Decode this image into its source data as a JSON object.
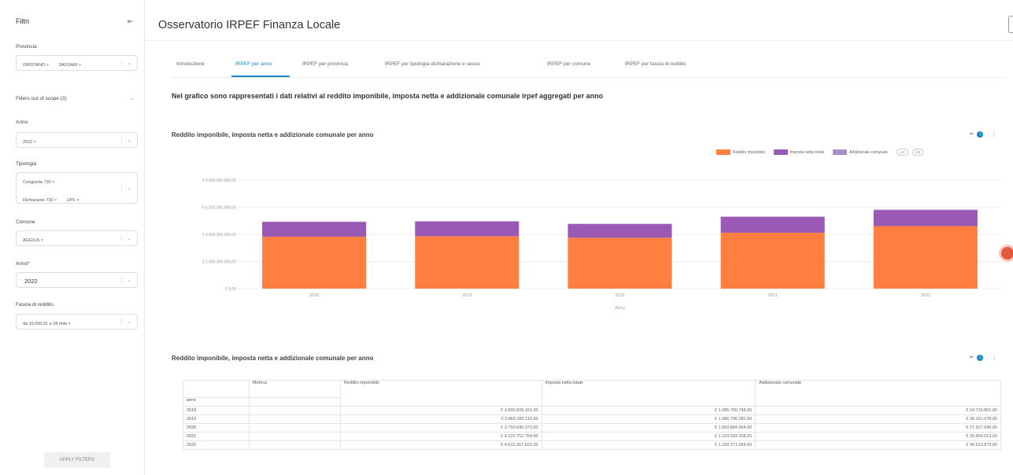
{
  "sidebar": {
    "title": "Filtri",
    "collapse_icon": "collapse-panel-icon",
    "filters": [
      {
        "label": "Provincia",
        "tags": [
          "ORISTANO ×",
          "SASSARI ×"
        ]
      },
      {
        "label": "Filters out of scope (3)"
      },
      {
        "label": "Anno",
        "tags": [
          "2022 ×"
        ]
      },
      {
        "label": "Tipologia",
        "tags_row1": [
          "Congiunta 730 ×"
        ],
        "tags_row2": [
          "Dichiarante 730 ×",
          "UPF ×"
        ]
      },
      {
        "label": "Comune",
        "tags": [
          "AGGIUS ×"
        ]
      },
      {
        "label": "Anno*",
        "value": "2022"
      },
      {
        "label": "Fascia di reddito",
        "tags": [
          "da 15.000,01 a 28 mila ×"
        ]
      }
    ],
    "apply_label": "APPLY FILTERS"
  },
  "header": {
    "title": "Osservatorio IRPEF Finanza Locale"
  },
  "tabs": [
    {
      "label": "Introduzione",
      "active": false
    },
    {
      "label": "IRPEF per anno",
      "active": true
    },
    {
      "label": "IRPEF per provincia",
      "active": false
    },
    {
      "label": "IRPEF per tipologia dichiarazione e sesso",
      "active": false
    },
    {
      "label": "IRPEF per comune",
      "active": false
    },
    {
      "label": "IRPEF per fascia di reddito",
      "active": false
    }
  ],
  "intro_text": "Nel grafico sono rappresentati i dati relativi al reddito imponibile, imposta netta e addizionale comunale irpef aggregati per anno",
  "chart_panel": {
    "title": "Reddito imponibile, imposta netta e addizionale comunale per anno",
    "legend": [
      {
        "name": "Reddito imponibile",
        "color": "#ff7f41"
      },
      {
        "name": "Imposta netta totale",
        "color": "#9b59b6"
      },
      {
        "name": "Addizionale comunale",
        "color": "#a98fc9"
      }
    ],
    "legend_pager": [
      "1/2",
      "2/2"
    ]
  },
  "chart_data": {
    "type": "bar",
    "stacked": true,
    "categories": [
      "2018",
      "2019",
      "2020",
      "2021",
      "2022"
    ],
    "series": [
      {
        "name": "Reddito imponibile",
        "values": [
          3830839151,
          3860280115,
          3750690373,
          4120752754,
          4610367822
        ]
      },
      {
        "name": "Imposta netta totale",
        "values": [
          1085765748,
          1086786282,
          1003864964,
          1163093208,
          1180371064
        ]
      },
      {
        "name": "Addizionale comunale",
        "values": [
          24716852,
          28161078,
          27927698,
          30904013,
          34513879
        ]
      }
    ],
    "ytick_labels": [
      "€ 8.000.000.000,00",
      "€ 6.000.000.000,00",
      "€ 4.000.000.000,00",
      "€ 2.000.000.000,00",
      "€ 0,00"
    ],
    "ytick_values": [
      8000000000,
      6000000000,
      4000000000,
      2000000000,
      0
    ],
    "ylim": [
      0,
      8000000000
    ],
    "xlabel": "Anno",
    "ylabel": ""
  },
  "table_panel": {
    "title": "Reddito imponibile, imposta netta e addizionale comunale per anno",
    "metric_header": "Metrica",
    "row_header": "anno",
    "columns": [
      "Reddito imponibile",
      "Imposta netta totale",
      "Addizionale comunale"
    ],
    "rows": [
      {
        "anno": "2018",
        "values": [
          "€ 3.830.839.151,00",
          "€ 1.085.765.748,00",
          "€ 24.716.852,00"
        ]
      },
      {
        "anno": "2019",
        "values": [
          "€ 3.860.280.115,00",
          "€ 1.086.786.282,00",
          "€ 28.161.078,00"
        ]
      },
      {
        "anno": "2020",
        "values": [
          "€ 3.750.690.373,00",
          "€ 1.003.864.964,00",
          "€ 27.927.698,00"
        ]
      },
      {
        "anno": "2021",
        "values": [
          "€ 4.120.752.754,00",
          "€ 1.163.093.208,00",
          "€ 30.904.013,00"
        ]
      },
      {
        "anno": "2022",
        "values": [
          "€ 4.610.367.822,00",
          "€ 1.180.371.064,00",
          "€ 34.513.879,00"
        ]
      }
    ]
  },
  "icons": {
    "filter": "filter-icon",
    "info": "info-icon",
    "more": "more-vertical-icon"
  }
}
